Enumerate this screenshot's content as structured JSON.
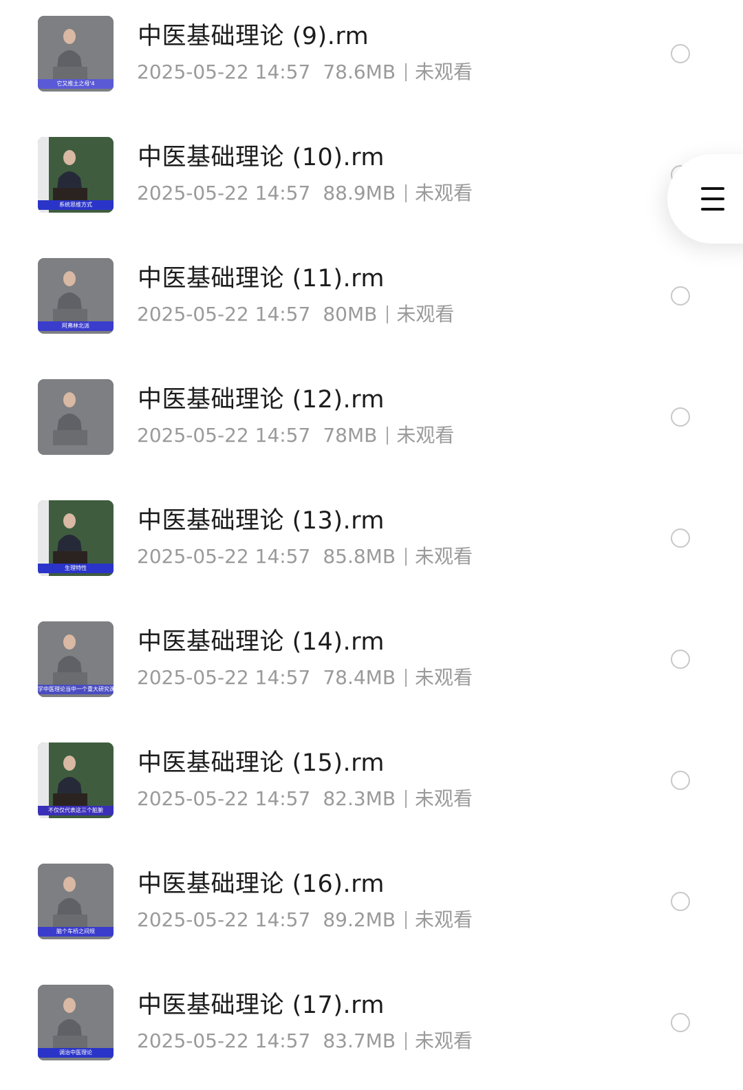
{
  "file_list": {
    "items": [
      {
        "name": "中医基础理论 (9).rm",
        "date": "2025-05-22 14:57",
        "size": "78.6MB",
        "status": "未观看",
        "caption": "它又推土之母'4",
        "caption_bg": "#5a5ad6"
      },
      {
        "name": "中医基础理论 (10).rm",
        "date": "2025-05-22 14:57",
        "size": "88.9MB",
        "status": "未观看",
        "caption": "系统思维方式",
        "caption_bg": "#2a34c8"
      },
      {
        "name": "中医基础理论 (11).rm",
        "date": "2025-05-22 14:57",
        "size": "80MB",
        "status": "未观看",
        "caption": "阿弗林北派",
        "caption_bg": "#3a3ccc"
      },
      {
        "name": "中医基础理论 (12).rm",
        "date": "2025-05-22 14:57",
        "size": "78MB",
        "status": "未观看",
        "caption": "",
        "caption_bg": "#7d7f82"
      },
      {
        "name": "中医基础理论 (13).rm",
        "date": "2025-05-22 14:57",
        "size": "85.8MB",
        "status": "未观看",
        "caption": "生理特性",
        "caption_bg": "#2a34c8"
      },
      {
        "name": "中医基础理论 (14).rm",
        "date": "2025-05-22 14:57",
        "size": "78.4MB",
        "status": "未观看",
        "caption": "学中医理论当中一个重大研究课题",
        "caption_bg": "#4a4cc0"
      },
      {
        "name": "中医基础理论 (15).rm",
        "date": "2025-05-22 14:57",
        "size": "82.3MB",
        "status": "未观看",
        "caption": "不仅仅代表这三个脏腑",
        "caption_bg": "#3a30b8"
      },
      {
        "name": "中医基础理论 (16).rm",
        "date": "2025-05-22 14:57",
        "size": "89.2MB",
        "status": "未观看",
        "caption": "脑个车桥之间规",
        "caption_bg": "#3a3ccc"
      },
      {
        "name": "中医基础理论 (17).rm",
        "date": "2025-05-22 14:57",
        "size": "83.7MB",
        "status": "未观看",
        "caption": "调治中医理论",
        "caption_bg": "#2a34c8"
      }
    ]
  },
  "colors": {
    "title_text": "#1c1c1c",
    "meta_text": "#9a9a9a",
    "radio_border": "#c8c8c8",
    "thumb_gray": "#7d7f82",
    "thumb_green_board": "#3f5d3e"
  },
  "icons": {
    "menu": "hamburger-menu-icon",
    "select": "radio-circle-icon"
  }
}
